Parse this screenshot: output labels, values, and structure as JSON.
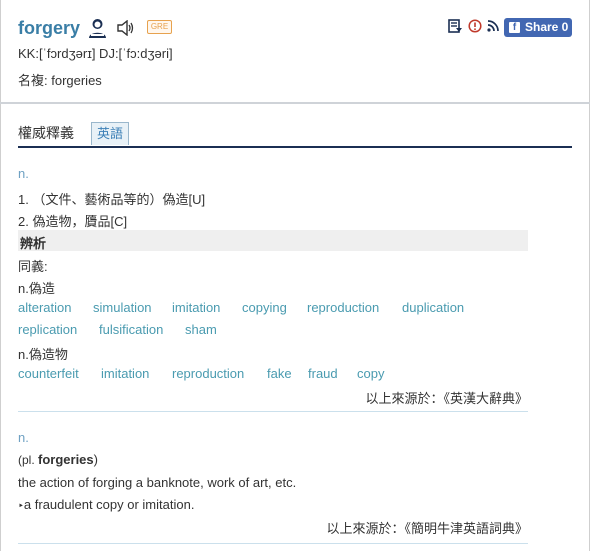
{
  "entry": {
    "word": "forgery",
    "badge": "GRE",
    "pronunciation": "KK:[ˈfɔrdʒərɪ] DJ:[ˈfɔ:dʒəri]",
    "plural_label": "名複: forgeries"
  },
  "toolbar": {
    "share_label": "Share 0",
    "icons": [
      "wordlist-icon",
      "report-icon",
      "rss-icon",
      "facebook-icon"
    ]
  },
  "tabs": {
    "active": "權威釋義",
    "english": "英語"
  },
  "section1": {
    "pos": "n.",
    "defs": [
      "1. （文件、藝術品等的）偽造[U]",
      "2. 偽造物，贗品[C]"
    ],
    "analysis_label": "辨析",
    "synonyms_label": "同義:",
    "group1_label": "n.偽造",
    "group1_row1": [
      "alteration",
      "simulation",
      "imitation",
      "copying",
      "reproduction",
      "duplication"
    ],
    "group1_row2": [
      "replication",
      "fulsification",
      "sham"
    ],
    "group2_label": "n.偽造物",
    "group2_row1": [
      "counterfeit",
      "imitation",
      "reproduction",
      "fake",
      "fraud",
      "copy"
    ],
    "source": "以上來源於：《英漢大辭典》"
  },
  "section2": {
    "pos": "n.",
    "plural_prefix": "(pl. ",
    "plural_word": "forgeries",
    "plural_suffix": ")",
    "def1": "the action of forging a banknote, work of art, etc.",
    "def2_marker": "‣",
    "def2": "a fraudulent copy or imitation.",
    "source": "以上來源於：《簡明牛津英語詞典》"
  },
  "colors": {
    "word": "#3a7ea6",
    "link": "#4a9bb0",
    "facebook": "#4267b2",
    "tab_underline": "#1b2f53"
  }
}
